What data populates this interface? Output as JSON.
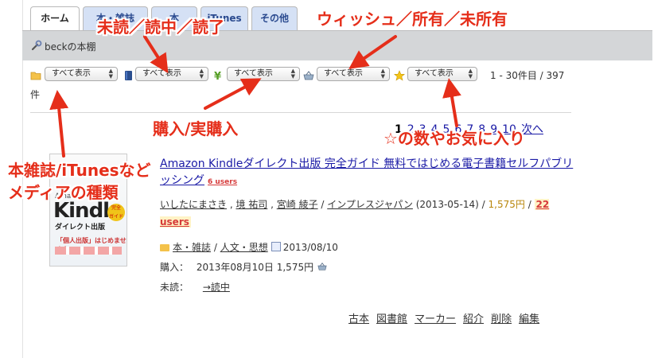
{
  "tabs": [
    {
      "label": "ホーム",
      "active": true
    },
    {
      "label": "本・雑誌",
      "active": false
    },
    {
      "label": "本",
      "active": false
    },
    {
      "label": "iTunes",
      "active": false
    },
    {
      "label": "その他",
      "active": false
    }
  ],
  "shelf_title": "beckの本棚",
  "filters": [
    {
      "icon": "folder-icon",
      "label": "すべて表示"
    },
    {
      "icon": "book-icon",
      "label": "すべて表示"
    },
    {
      "icon": "yen-icon",
      "label": "すべて表示"
    },
    {
      "icon": "basket-icon",
      "label": "すべて表示"
    },
    {
      "icon": "star-icon",
      "label": "すべて表示"
    }
  ],
  "count_text": "1 - 30件目 / 397",
  "count_suffix": "件",
  "pager": {
    "current": "1",
    "pages": [
      "2",
      "3",
      "4",
      "5",
      "6",
      "7",
      "8",
      "9",
      "10"
    ],
    "next": "次へ"
  },
  "book": {
    "cover_lines": [
      "Amazon",
      "Kindle",
      "ダイレクト出版",
      "「個人出版」はじめませんか?"
    ],
    "title": "Amazon Kindleダイレクト出版 完全ガイド 無料ではじめる電子書籍セルフパブリッシング",
    "users_small": "6 users",
    "authors": [
      "いしたにまさき",
      "境 祐司",
      "宮崎 綾子"
    ],
    "publisher": "インプレスジャパン",
    "date": "(2013-05-14)",
    "price": "1,575円",
    "users_big": "22 users",
    "category": "本・雑誌",
    "genre": "人文・思想",
    "added_date": "2013/08/10",
    "purchase_label": "購入：",
    "purchase_value": "2013年08月10日 1,575円",
    "status_label": "未読：",
    "status_action": "→読中"
  },
  "actions": [
    "古本",
    "図書館",
    "マーカー",
    "紹介",
    "削除",
    "編集"
  ],
  "annotations": {
    "read_status": "未読／読中／読了",
    "wish": "ウィッシュ／所有／未所有",
    "purchase": "購入/実購入",
    "stars": "☆の数やお気に入り",
    "media_line1": "本雑誌/iTunesなど",
    "media_line2": "メディアの種類"
  },
  "colors": {
    "annotation": "#e52e1a",
    "link": "#1a1aa6",
    "tab": "#d5e1f5",
    "bar": "#d4d6d8"
  }
}
